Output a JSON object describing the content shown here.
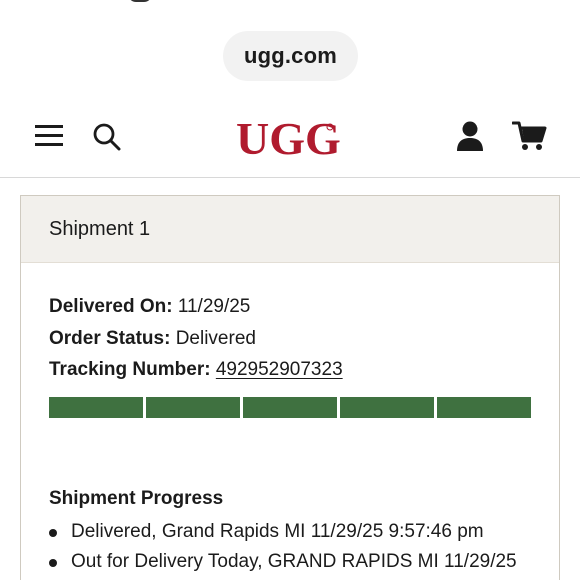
{
  "browser": {
    "url": "ugg.com"
  },
  "header": {
    "brand": "UGG",
    "brand_color": "#b01b2e"
  },
  "shipment": {
    "title": "Shipment 1",
    "delivered_label": "Delivered On:",
    "delivered_value": "11/29/25",
    "status_label": "Order Status:",
    "status_value": "Delivered",
    "tracking_label": "Tracking Number:",
    "tracking_value": "492952907323",
    "progress_fraction": 1.0,
    "progress_color": "#3f7140",
    "progress_title": "Shipment Progress",
    "events": [
      {
        "text": "Delivered, Grand Rapids MI 11/29/25 9:57:46 pm"
      },
      {
        "text": "Out for Delivery Today, GRAND RAPIDS MI 11/29/25"
      }
    ]
  }
}
